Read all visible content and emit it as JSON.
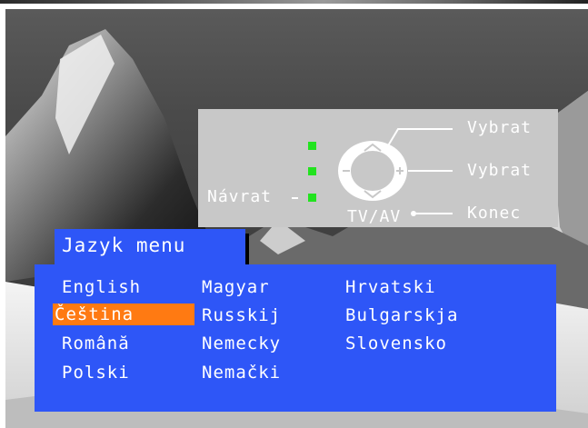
{
  "help": {
    "select_up": "Vybrat",
    "select_side": "Vybrat",
    "end": "Konec",
    "back": "Návrat",
    "tvav": "TV/AV"
  },
  "menu": {
    "title": "Jazyk menu",
    "columns": [
      [
        "English",
        "Čeština",
        "Română",
        "Polski"
      ],
      [
        "Magyar",
        "Russkij",
        "Nemecky",
        "Nemački"
      ],
      [
        "Hrvatski",
        "Bulgarskja",
        "Slovensko"
      ]
    ],
    "selected": "Čeština"
  },
  "colors": {
    "panel_blue": "#2e56f7",
    "selection_orange": "#ff7a12",
    "indicator_green": "#22e31f",
    "help_grey": "#c8c8c8"
  }
}
